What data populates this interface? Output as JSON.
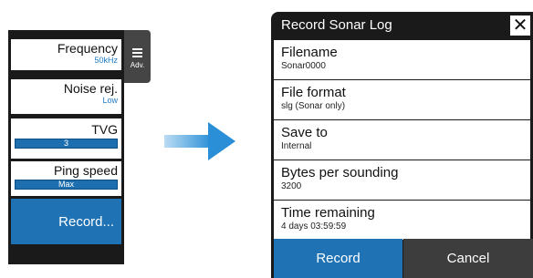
{
  "menu": {
    "items": [
      {
        "label": "Frequency",
        "value": "50kHz"
      },
      {
        "label": "Noise rej.",
        "value": "Low"
      },
      {
        "label": "TVG",
        "value": "3"
      },
      {
        "label": "Ping speed",
        "value": "Max"
      }
    ],
    "record_label": "Record...",
    "adv_label": "Adv."
  },
  "dialog": {
    "title": "Record Sonar Log",
    "close_symbol": "✕",
    "fields": [
      {
        "label": "Filename",
        "value": "Sonar0000"
      },
      {
        "label": "File format",
        "value": "slg (Sonar only)"
      },
      {
        "label": "Save to",
        "value": "Internal"
      },
      {
        "label": "Bytes per sounding",
        "value": "3200"
      },
      {
        "label": "Time remaining",
        "value": "4 days 03:59:59"
      }
    ],
    "record_button": "Record",
    "cancel_button": "Cancel"
  },
  "colors": {
    "accent": "#1f72b4",
    "value_text": "#1e7bc6",
    "panel_bg": "#1a1a1a",
    "arrow": "#2a8fd6"
  }
}
